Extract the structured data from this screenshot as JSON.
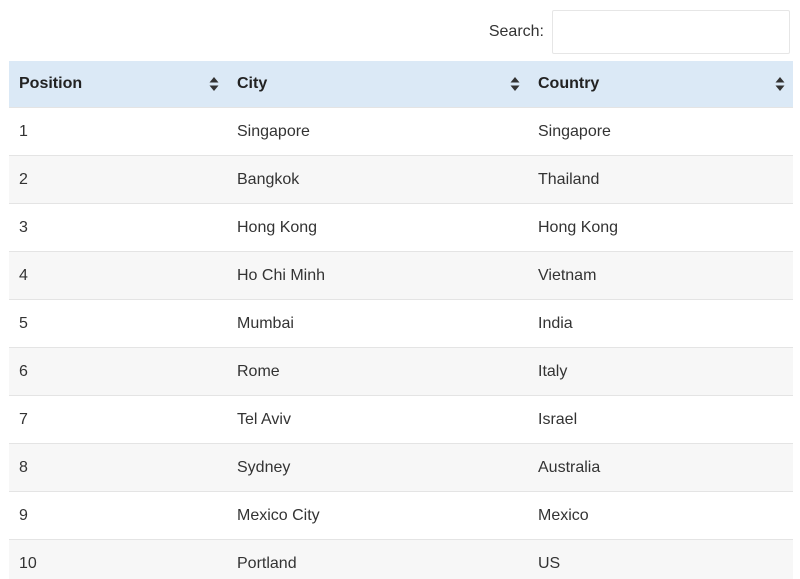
{
  "search": {
    "label": "Search:",
    "value": "",
    "placeholder": ""
  },
  "table": {
    "columns": [
      "Position",
      "City",
      "Country"
    ],
    "rows": [
      {
        "position": "1",
        "city": "Singapore",
        "country": "Singapore"
      },
      {
        "position": "2",
        "city": "Bangkok",
        "country": "Thailand"
      },
      {
        "position": "3",
        "city": "Hong Kong",
        "country": "Hong Kong"
      },
      {
        "position": "4",
        "city": "Ho Chi Minh",
        "country": "Vietnam"
      },
      {
        "position": "5",
        "city": "Mumbai",
        "country": "India"
      },
      {
        "position": "6",
        "city": "Rome",
        "country": "Italy"
      },
      {
        "position": "7",
        "city": "Tel Aviv",
        "country": "Israel"
      },
      {
        "position": "8",
        "city": "Sydney",
        "country": "Australia"
      },
      {
        "position": "9",
        "city": "Mexico City",
        "country": "Mexico"
      },
      {
        "position": "10",
        "city": "Portland",
        "country": "US"
      }
    ]
  },
  "colors": {
    "header_bg": "#dbe9f6",
    "stripe_bg": "#f7f7f7"
  },
  "icons": {
    "sort": "sort-both-icon"
  }
}
